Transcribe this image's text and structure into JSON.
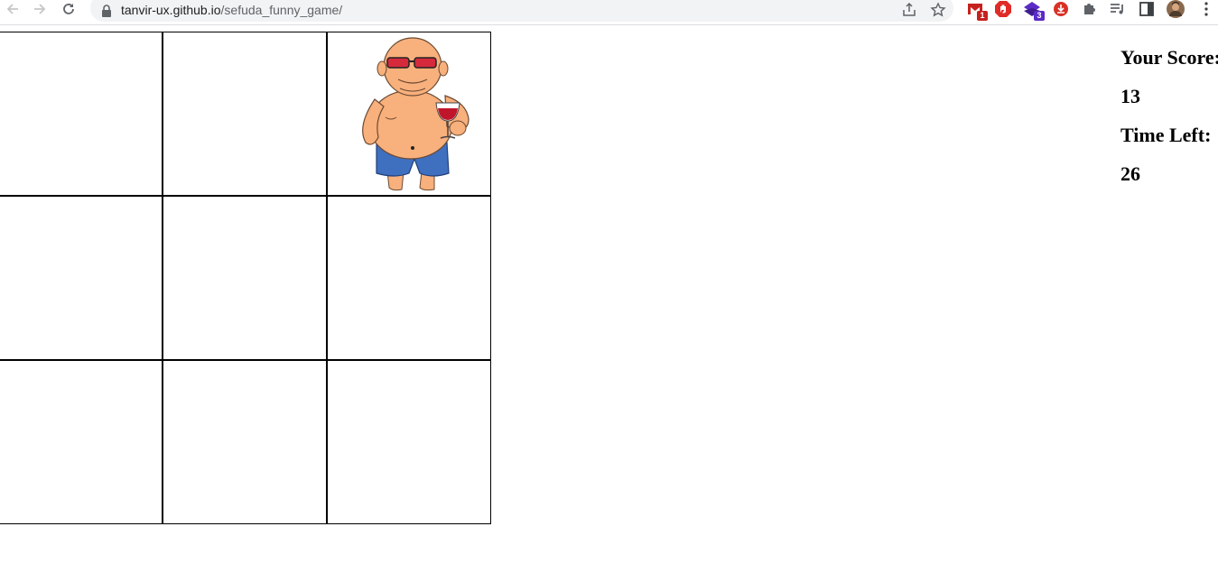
{
  "browser": {
    "url_host": "tanvir-ux.github.io",
    "url_path": "/sefuda_funny_game/",
    "extensions": [
      {
        "icon": "gmail-icon",
        "badge": "1",
        "color": "#c5221f"
      },
      {
        "icon": "adblock-icon",
        "badge": "",
        "color": "#e02b27"
      },
      {
        "icon": "extension-stack-icon",
        "badge": "3",
        "color": "#5b2bc6"
      },
      {
        "icon": "download-ext-icon",
        "badge": "",
        "color": "#d93025"
      }
    ]
  },
  "game": {
    "board_rows": 3,
    "board_cols": 3,
    "active_square": 3,
    "character": "bald-man-with-wine-glass"
  },
  "score_panel": {
    "score_label": "Your Score:",
    "score_value": "13",
    "time_label": "Time Left:",
    "time_value": "26"
  }
}
